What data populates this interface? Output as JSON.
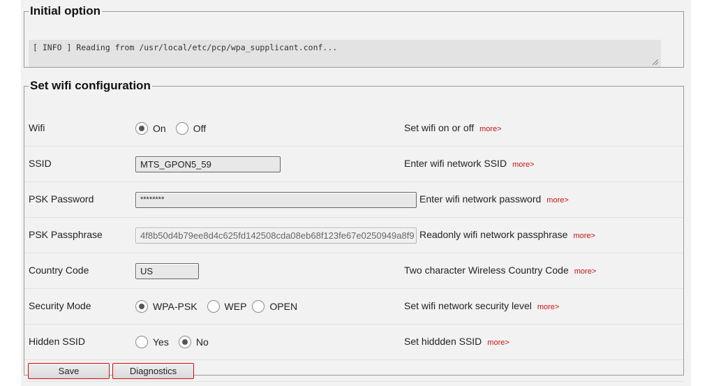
{
  "initial": {
    "legend": "Initial option",
    "log_text": "[ INFO ] Reading from /usr/local/etc/pcp/wpa_supplicant.conf..."
  },
  "wifi": {
    "legend": "Set wifi configuration",
    "more_label": "more>",
    "rows": {
      "wifi": {
        "label": "Wifi",
        "options": [
          "On",
          "Off"
        ],
        "selected": "On",
        "help": "Set wifi on or off"
      },
      "ssid": {
        "label": "SSID",
        "value": "MTS_GPON5_59",
        "help": "Enter wifi network SSID"
      },
      "psk_password": {
        "label": "PSK Password",
        "value": "********",
        "help": "Enter wifi network password"
      },
      "psk_passphrase": {
        "label": "PSK Passphrase",
        "value": "4f8b50d4b79ee8d4c625fd142508cda08eb68f123fe67e0250949a8f9",
        "help": "Readonly wifi network passphrase"
      },
      "country_code": {
        "label": "Country Code",
        "value": "US",
        "help": "Two character Wireless Country Code"
      },
      "security_mode": {
        "label": "Security Mode",
        "options": [
          "WPA-PSK",
          "WEP",
          "OPEN"
        ],
        "selected": "WPA-PSK",
        "help": "Set wifi network security level"
      },
      "hidden_ssid": {
        "label": "Hidden SSID",
        "options": [
          "Yes",
          "No"
        ],
        "selected": "No",
        "help": "Set hiddden SSID"
      }
    },
    "buttons": {
      "save": "Save",
      "diagnostics": "Diagnostics"
    }
  },
  "colors": {
    "more_link": "#cc1111",
    "button_border": "#cc1111",
    "panel_bg": "#f2f2f2"
  }
}
